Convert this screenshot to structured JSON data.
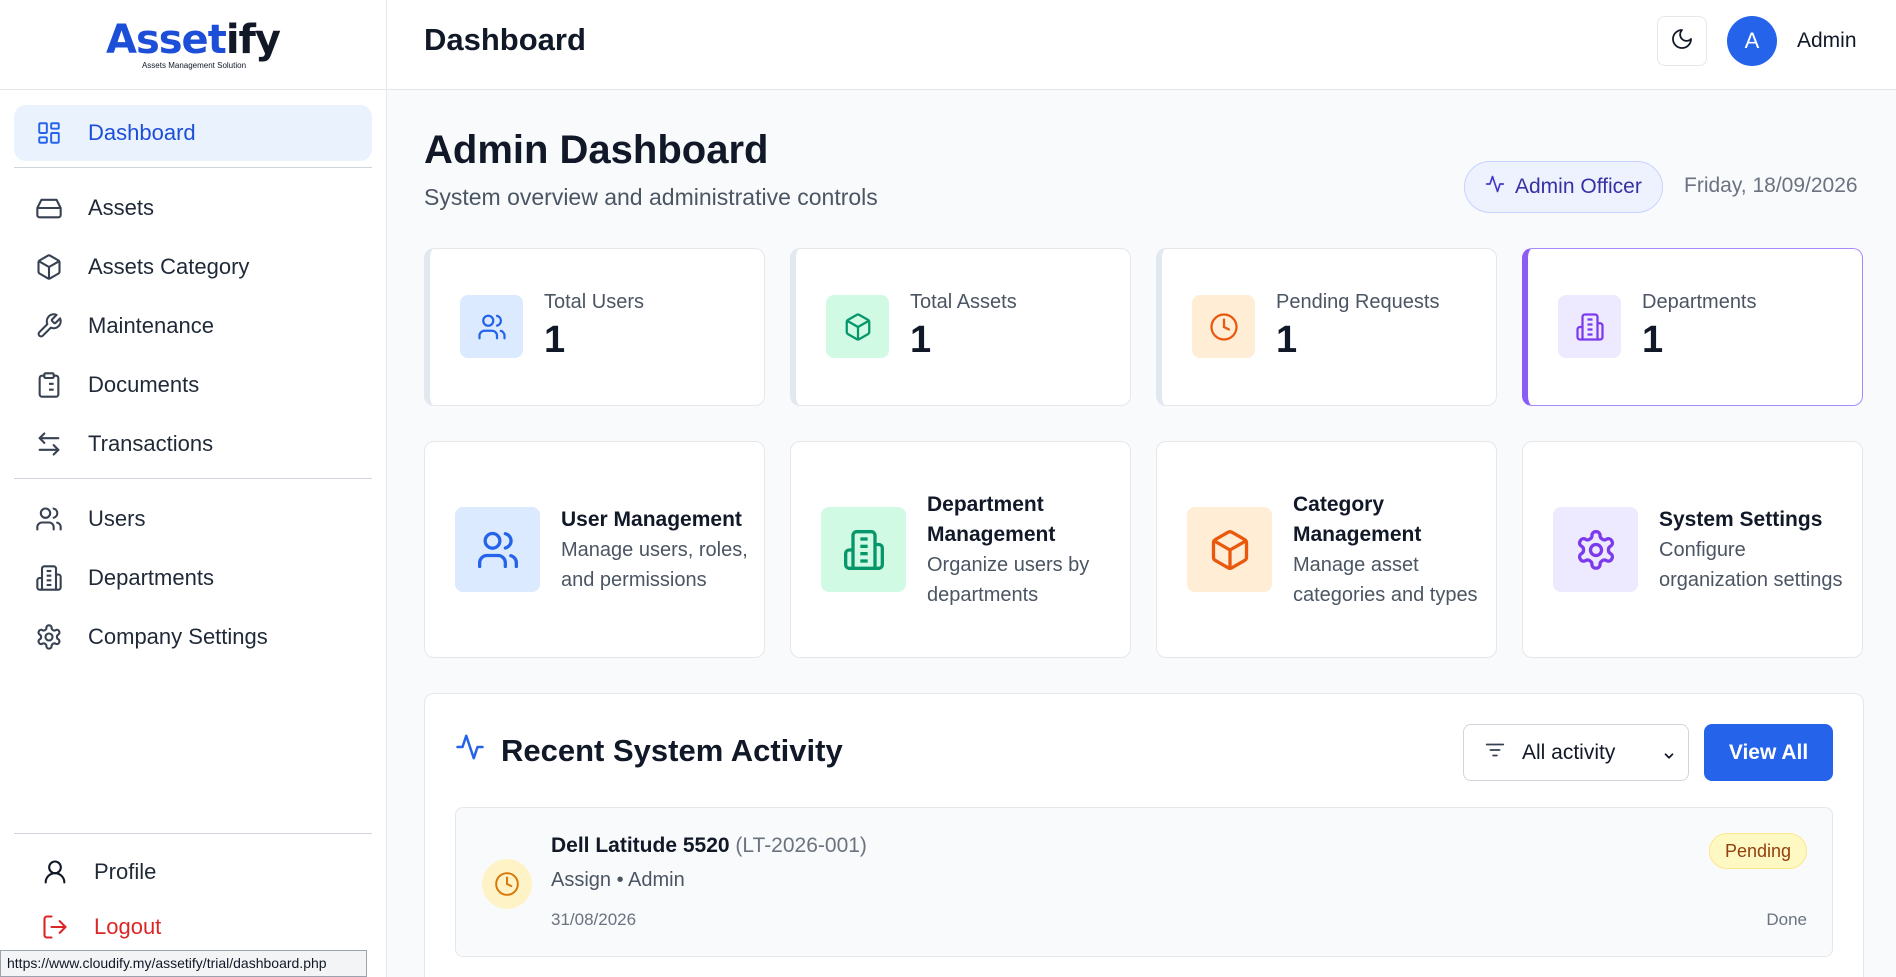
{
  "brand": {
    "name_part1": "Asset",
    "name_part2": "ify",
    "tagline": "Assets Management Solution"
  },
  "sidebar": {
    "items": [
      {
        "label": "Dashboard",
        "icon": "dashboard-icon",
        "active": true
      },
      {
        "label": "Assets",
        "icon": "hard-drive-icon"
      },
      {
        "label": "Assets Category",
        "icon": "box-icon"
      },
      {
        "label": "Maintenance",
        "icon": "wrench-icon"
      },
      {
        "label": "Documents",
        "icon": "clipboard-icon"
      },
      {
        "label": "Transactions",
        "icon": "arrows-left-right-icon"
      },
      {
        "label": "Users",
        "icon": "users-icon"
      },
      {
        "label": "Departments",
        "icon": "building-icon"
      },
      {
        "label": "Company Settings",
        "icon": "gear-icon"
      }
    ],
    "bottom": [
      {
        "label": "Profile",
        "icon": "user-icon"
      },
      {
        "label": "Logout",
        "icon": "logout-icon"
      }
    ]
  },
  "status_bar": {
    "url": "https://www.cloudify.my/assetify/trial/dashboard.php"
  },
  "header": {
    "title": "Dashboard",
    "user_initial": "A",
    "user_name": "Admin"
  },
  "page": {
    "title": "Admin Dashboard",
    "subtitle": "System overview and administrative controls",
    "role_badge": "Admin Officer",
    "date": "Friday, 18/09/2026"
  },
  "stats": [
    {
      "label": "Total Users",
      "value": "1",
      "icon": "users-icon",
      "color": "#2563eb",
      "bg": "#dbeafe"
    },
    {
      "label": "Total Assets",
      "value": "1",
      "icon": "box-icon",
      "color": "#059669",
      "bg": "#d1fae5"
    },
    {
      "label": "Pending Requests",
      "value": "1",
      "icon": "clock-icon",
      "color": "#ea580c",
      "bg": "#ffedd5"
    },
    {
      "label": "Departments",
      "value": "1",
      "icon": "building-icon",
      "color": "#7c3aed",
      "bg": "#ede9fe"
    }
  ],
  "management_cards": [
    {
      "title": "User Management",
      "description": "Manage users, roles, and permissions",
      "icon": "users-icon",
      "color": "#2563eb",
      "bg": "#dbeafe"
    },
    {
      "title": "Department Management",
      "description": "Organize users by departments",
      "icon": "building-icon",
      "color": "#059669",
      "bg": "#d1fae5"
    },
    {
      "title": "Category Management",
      "description": "Manage asset categories and types",
      "icon": "box-icon",
      "color": "#ea580c",
      "bg": "#ffedd5"
    },
    {
      "title": "System Settings",
      "description": "Configure organization settings",
      "icon": "gear-icon",
      "color": "#7c3aed",
      "bg": "#ede9fe"
    }
  ],
  "activity": {
    "title": "Recent System Activity",
    "filter_value": "All activity",
    "view_all_label": "View All",
    "items": [
      {
        "name": "Dell Latitude 5520",
        "code": "(LT-2026-001)",
        "meta": "Assign • Admin",
        "date": "31/08/2026",
        "status": "Pending",
        "note": "Done"
      }
    ]
  }
}
